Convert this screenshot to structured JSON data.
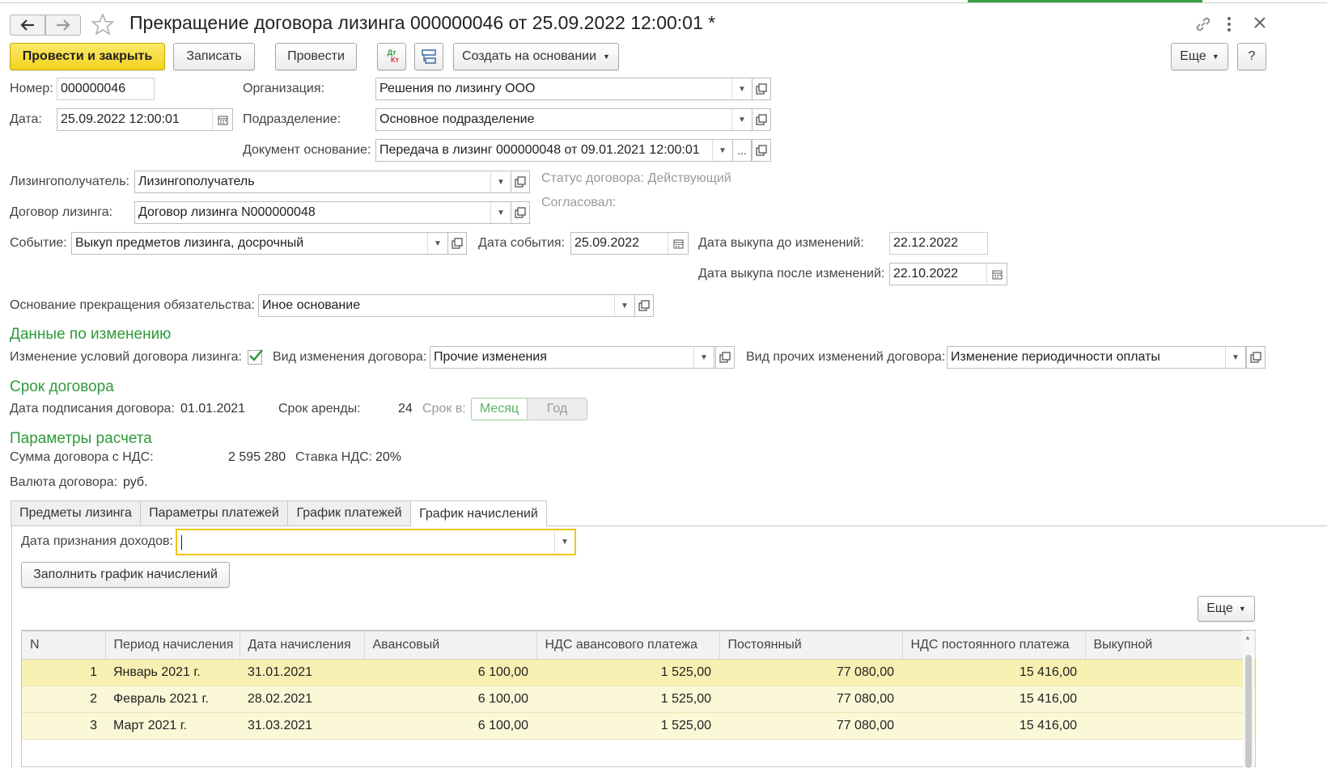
{
  "window": {
    "title": "Прекращение договора лизинга 000000046 от 25.09.2022 12:00:01 *"
  },
  "toolbar": {
    "post_close": "Провести и закрыть",
    "save": "Записать",
    "post": "Провести",
    "dtkt_top": "Дт",
    "dtkt_bottom": "Кт",
    "create_based": "Создать на основании",
    "more": "Еще",
    "help": "?"
  },
  "header": {
    "number_label": "Номер:",
    "number_value": "000000046",
    "date_label": "Дата:",
    "date_value": "25.09.2022 12:00:01",
    "org_label": "Организация:",
    "org_value": "Решения по лизингу ООО",
    "dept_label": "Подразделение:",
    "dept_value": "Основное подразделение",
    "basis_label": "Документ основание:",
    "basis_value": "Передача в лизинг 000000048 от 09.01.2021 12:00:01",
    "basis_select": "..."
  },
  "lessee": {
    "label": "Лизингополучатель:",
    "value": "Лизингополучатель",
    "contract_label": "Договор лизинга:",
    "contract_value": "Договор лизинга N000000048",
    "status_text": "Статус договора: Действующий",
    "approved_text": "Согласовал:"
  },
  "event": {
    "label": "Событие:",
    "value": "Выкуп предметов лизинга, досрочный",
    "date_label": "Дата события:",
    "date_value": "25.09.2022",
    "buyout_before_label": "Дата выкупа до изменений:",
    "buyout_before_value": "22.12.2022",
    "buyout_after_label": "Дата выкупа после изменений:",
    "buyout_after_value": "22.10.2022"
  },
  "termination": {
    "label": "Основание прекращения обязательства:",
    "value": "Иное основание"
  },
  "change": {
    "section": "Данные по изменению",
    "terms_label": "Изменение условий договора лизинга:",
    "terms_checked": true,
    "kind_label": "Вид изменения договора:",
    "kind_value": "Прочие изменения",
    "other_label": "Вид прочих изменений договора:",
    "other_value": "Изменение периодичности оплаты"
  },
  "term": {
    "section": "Срок договора",
    "sign_label": "Дата подписания договора:",
    "sign_value": "01.01.2021",
    "lease_label": "Срок аренды:",
    "lease_value": "24",
    "unit_label": "Срок в:",
    "unit_month": "Месяц",
    "unit_year": "Год",
    "unit_selected": "Месяц"
  },
  "calc": {
    "section": "Параметры расчета",
    "sum_label": "Сумма договора с НДС:",
    "sum_value": "2 595 280",
    "vat_label": "Ставка НДС:",
    "vat_value": "20%",
    "currency_label": "Валюта договора:",
    "currency_value": "руб."
  },
  "tabs": [
    "Предметы лизинга",
    "Параметры платежей",
    "График платежей",
    "График начислений"
  ],
  "active_tab": "График начислений",
  "accruals": {
    "income_date_label": "Дата признания доходов:",
    "income_date_value": "",
    "fill_button": "Заполнить график начислений",
    "more": "Еще",
    "columns": [
      "N",
      "Период начисления",
      "Дата начисления",
      "Авансовый",
      "НДС авансового платежа",
      "Постоянный",
      "НДС постоянного платежа",
      "Выкупной"
    ],
    "rows": [
      [
        "1",
        "Январь 2021 г.",
        "31.01.2021",
        "6 100,00",
        "1 525,00",
        "77 080,00",
        "15 416,00",
        ""
      ],
      [
        "2",
        "Февраль 2021 г.",
        "28.02.2021",
        "6 100,00",
        "1 525,00",
        "77 080,00",
        "15 416,00",
        ""
      ],
      [
        "3",
        "Март 2021 г.",
        "31.03.2021",
        "6 100,00",
        "1 525,00",
        "77 080,00",
        "15 416,00",
        ""
      ]
    ]
  },
  "colors": {
    "accent_green": "#2f9a3a",
    "primary_yellow": "#f2d21e",
    "row_highlight": "#fbf8d8"
  }
}
